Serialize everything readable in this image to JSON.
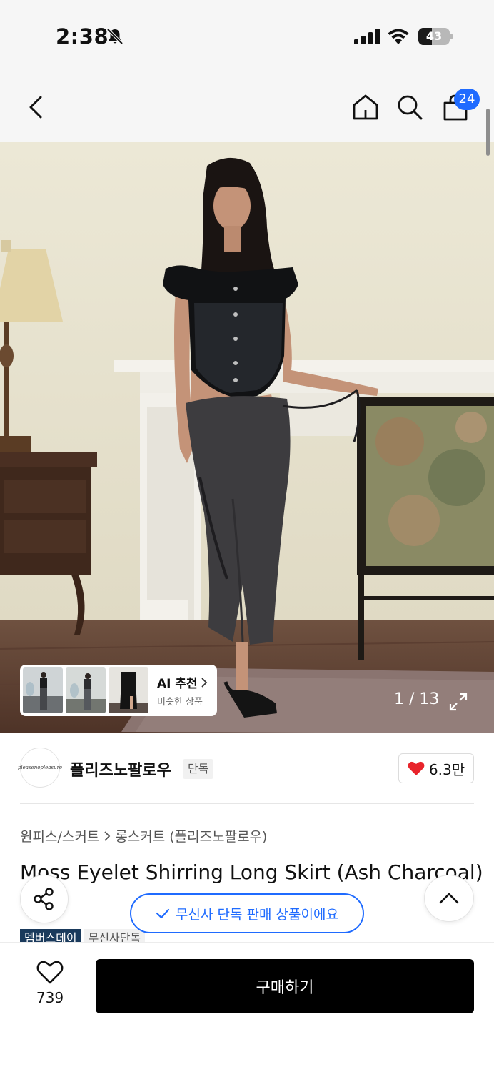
{
  "status_bar": {
    "time": "2:38",
    "battery_level": "43",
    "battery_fraction": 0.43,
    "icons": [
      "bell-off-icon",
      "cellular-signal-icon",
      "wifi-icon",
      "battery-icon"
    ]
  },
  "nav": {
    "icons": [
      "chevron-left-icon",
      "home-icon",
      "search-icon",
      "shopping-bag-icon"
    ],
    "cart_count": "24"
  },
  "gallery": {
    "ai_title": "AI 추천",
    "ai_subtitle": "비슷한 상품",
    "counter": "1 / 13"
  },
  "brand": {
    "logo_text": "pleasenopleasure",
    "name": "플리즈노팔로우",
    "tag": "단독",
    "likes": "6.3만"
  },
  "product": {
    "breadcrumb": [
      "원피스/스커트",
      "롱스커트 (플리즈노팔로우)"
    ],
    "title": "Moss Eyelet Shirring Long Skirt (Ash Charcoal)",
    "tags": [
      "멤버스데이",
      "무신사단독"
    ]
  },
  "notice": {
    "text": "무신사 단독 판매 상품이에요"
  },
  "bottom_bar": {
    "wish_count": "739",
    "buy_label": "구매하기"
  },
  "colors": {
    "accent_blue": "#1f6bff",
    "heart_red": "#e8242b",
    "buy_button": "#000000",
    "member_tag": "#1a3a5c"
  }
}
